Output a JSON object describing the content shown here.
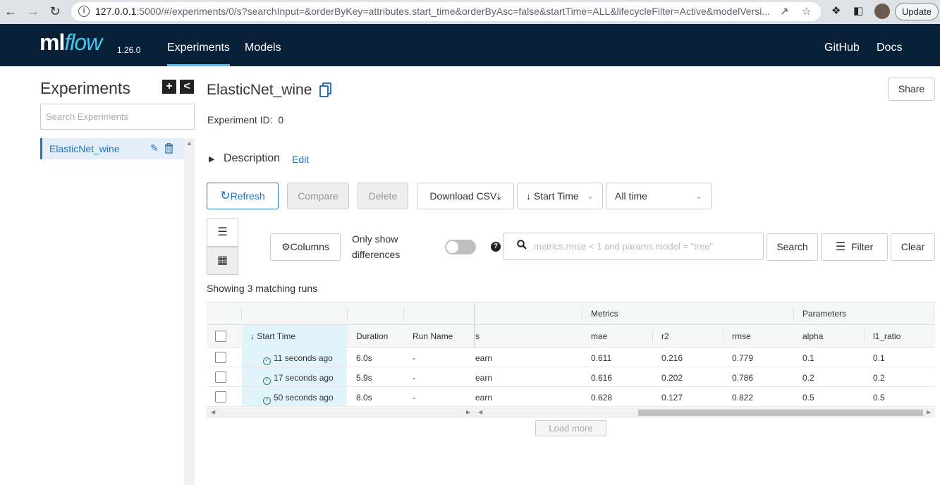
{
  "browser": {
    "url_host": "127.0.0.1",
    "url_rest": ":5000/#/experiments/0/s?searchInput=&orderByKey=attributes.start_time&orderByAsc=false&startTime=ALL&lifecycleFilter=Active&modelVersi...",
    "update_label": "Update"
  },
  "header": {
    "logo_ml": "ml",
    "logo_flow": "flow",
    "version": "1.26.0",
    "nav": [
      "Experiments",
      "Models"
    ],
    "right_links": [
      "GitHub",
      "Docs"
    ],
    "brand_color": "#082138",
    "accent_color": "#43c9ed"
  },
  "sidebar": {
    "title": "Experiments",
    "add_icon": "+",
    "collapse_icon": "<",
    "search_placeholder": "Search Experiments",
    "items": [
      {
        "label": "ElasticNet_wine"
      }
    ]
  },
  "experiment": {
    "name": "ElasticNet_wine",
    "id_label": "Experiment ID:",
    "id_value": "0",
    "share_label": "Share",
    "description_label": "Description",
    "edit_label": "Edit"
  },
  "toolbar": {
    "refresh": "Refresh",
    "compare": "Compare",
    "delete": "Delete",
    "download_csv": "Download CSV",
    "sort": "Start Time",
    "time_range": "All time"
  },
  "filters": {
    "columns": "Columns",
    "only_show_line1": "Only show",
    "only_show_line2": "differences",
    "only_show_toggle": false,
    "search_placeholder": "metrics.rmse < 1 and params.model = \"tree\"",
    "search_btn": "Search",
    "filter_btn": "Filter",
    "clear_btn": "Clear"
  },
  "runs_summary": "Showing 3 matching runs",
  "table": {
    "group_headers": {
      "metrics": "Metrics",
      "parameters": "Parameters"
    },
    "columns": {
      "start_time": "Start Time",
      "duration": "Duration",
      "run_name": "Run Name",
      "models_fragment": "s",
      "mae": "mae",
      "r2": "r2",
      "rmse": "rmse",
      "alpha": "alpha",
      "l1_ratio": "l1_ratio"
    },
    "rows": [
      {
        "start": "11 seconds ago",
        "duration": "6.0s",
        "run_name": "-",
        "model": "earn",
        "mae": "0.611",
        "r2": "0.216",
        "rmse": "0.779",
        "alpha": "0.1",
        "l1_ratio": "0.1"
      },
      {
        "start": "17 seconds ago",
        "duration": "5.9s",
        "run_name": "-",
        "model": "earn",
        "mae": "0.616",
        "r2": "0.202",
        "rmse": "0.786",
        "alpha": "0.2",
        "l1_ratio": "0.2"
      },
      {
        "start": "50 seconds ago",
        "duration": "8.0s",
        "run_name": "-",
        "model": "earn",
        "mae": "0.628",
        "r2": "0.127",
        "rmse": "0.822",
        "alpha": "0.5",
        "l1_ratio": "0.5"
      }
    ]
  },
  "load_more": "Load more"
}
